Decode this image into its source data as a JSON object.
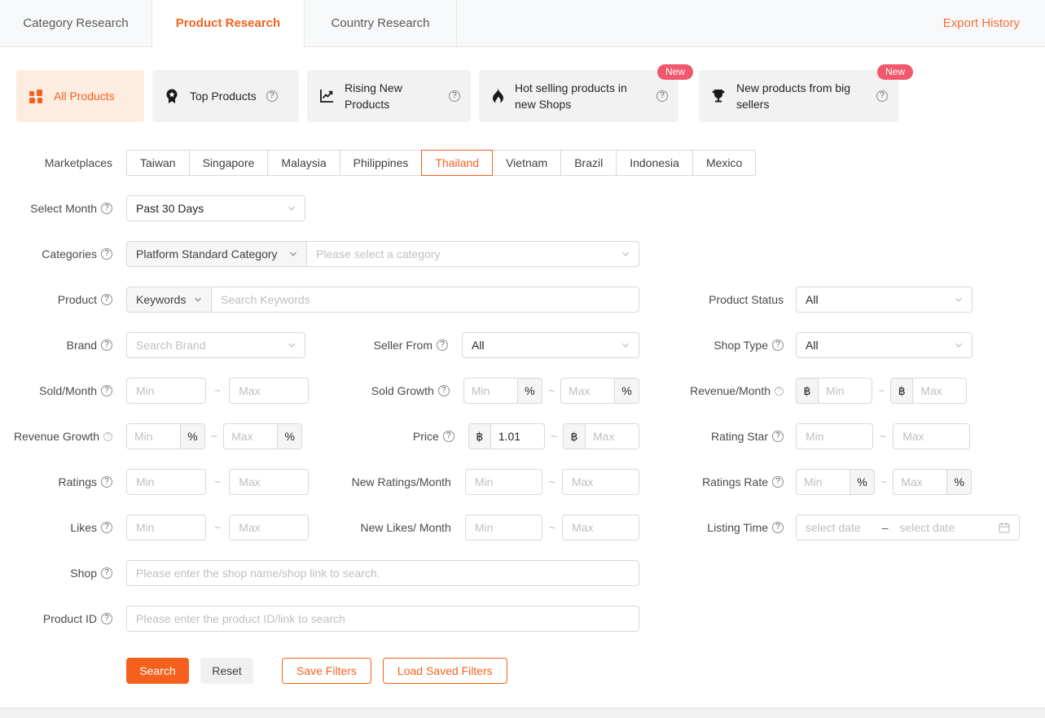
{
  "colors": {
    "accent": "#F5611F",
    "badge": "#F0586C",
    "active_card_bg": "#FDECE0"
  },
  "icons": {
    "help": "?"
  },
  "tabs": {
    "items": [
      {
        "label": "Category Research"
      },
      {
        "label": "Product Research"
      },
      {
        "label": "Country Research"
      }
    ],
    "active": "Product Research",
    "export_history": "Export History"
  },
  "cards": {
    "all_products": {
      "label": "All Products",
      "icon": "grid-icon",
      "active": true
    },
    "top_products": {
      "label": "Top Products",
      "icon": "medal-icon"
    },
    "rising_new": {
      "label": "Rising New Products",
      "icon": "trend-icon"
    },
    "hot_new_shops": {
      "label": "Hot selling products in new Shops",
      "icon": "flame-icon",
      "badge": "New"
    },
    "new_big_sellers": {
      "label": "New products from big sellers",
      "icon": "trophy-icon",
      "badge": "New"
    }
  },
  "form": {
    "range": {
      "min": "Min",
      "max": "Max",
      "tilde": "~"
    },
    "percent": "%",
    "currency": "฿",
    "marketplaces": {
      "label": "Marketplaces",
      "options": [
        "Taiwan",
        "Singapore",
        "Malaysia",
        "Philippines",
        "Thailand",
        "Vietnam",
        "Brazil",
        "Indonesia",
        "Mexico"
      ],
      "selected": "Thailand"
    },
    "select_month": {
      "label": "Select Month",
      "value": "Past 30 Days"
    },
    "categories": {
      "label": "Categories",
      "type_value": "Platform Standard Category",
      "placeholder": "Please select a category"
    },
    "product": {
      "label": "Product",
      "type_value": "Keywords",
      "placeholder": "Search Keywords"
    },
    "product_status": {
      "label": "Product Status",
      "value": "All"
    },
    "brand": {
      "label": "Brand",
      "placeholder": "Search Brand"
    },
    "seller_from": {
      "label": "Seller From",
      "value": "All"
    },
    "shop_type": {
      "label": "Shop Type",
      "value": "All"
    },
    "sold_month": {
      "label": "Sold/Month"
    },
    "sold_growth": {
      "label": "Sold Growth"
    },
    "revenue_month": {
      "label": "Revenue/Month"
    },
    "revenue_growth": {
      "label": "Revenue Growth"
    },
    "price": {
      "label": "Price",
      "min_value": "1.01"
    },
    "rating_star": {
      "label": "Rating Star"
    },
    "ratings": {
      "label": "Ratings"
    },
    "new_ratings_month": {
      "label": "New Ratings/Month"
    },
    "ratings_rate": {
      "label": "Ratings Rate"
    },
    "likes": {
      "label": "Likes"
    },
    "new_likes_month": {
      "label": "New Likes/ Month"
    },
    "listing_time": {
      "label": "Listing Time",
      "start_placeholder": "select date",
      "end_placeholder": "select date",
      "separator": "–"
    },
    "shop": {
      "label": "Shop",
      "placeholder": "Please enter the shop name/shop link to search."
    },
    "product_id": {
      "label": "Product ID",
      "placeholder": "Please enter the product ID/link to search"
    }
  },
  "actions": {
    "search": "Search",
    "reset": "Reset",
    "save_filters": "Save Filters",
    "load_saved_filters": "Load Saved Filters"
  }
}
